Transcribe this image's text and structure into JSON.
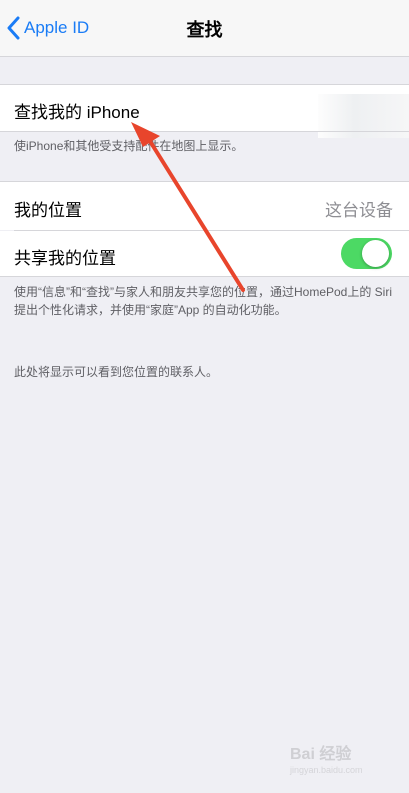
{
  "nav": {
    "back_label": "Apple ID",
    "title": "查找"
  },
  "find_my": {
    "label": "查找我的 iPhone",
    "footnote": "使iPhone和其他受支持配件在地图上显示。"
  },
  "location": {
    "my_location_label": "我的位置",
    "my_location_value": "这台设备",
    "share_label": "共享我的位置",
    "share_enabled": true,
    "share_footnote": "使用“信息”和“查找”与家人和朋友共享您的位置，通过HomePod上的 Siri 提出个性化请求，并使用“家庭”App 的自动化功能。"
  },
  "contacts_footnote": "此处将显示可以看到您位置的联系人。",
  "watermark": {
    "text": "Bai 经验",
    "sub": "jingyan.baidu.com"
  },
  "colors": {
    "accent": "#1a7cf6",
    "toggle_on": "#4cd964",
    "annotation_arrow": "#e8452c"
  },
  "icons": {
    "back": "chevron-left-icon",
    "annotation": "arrow-annotation"
  }
}
